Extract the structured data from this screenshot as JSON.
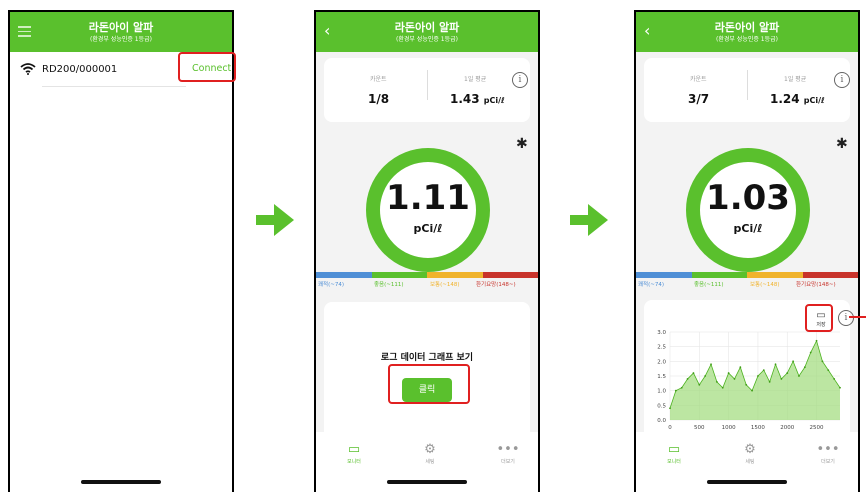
{
  "colors": {
    "brand": "#5ac02d",
    "highlight": "#e02020",
    "scale": [
      "#4f8fd6",
      "#5ac02d",
      "#f0b32c",
      "#c8332b"
    ]
  },
  "app": {
    "title": "라돈아이 알파",
    "subtitle": "(환경부 성능인증 1등급)"
  },
  "screen1": {
    "device_name": "RD200/000001",
    "connect_label": "Connect",
    "icons": {
      "menu": "menu-icon",
      "wifi": "wifi-icon"
    }
  },
  "screen2": {
    "count_label": "카운트",
    "count_value": "1/8",
    "avg_label": "1일 평균",
    "avg_value": "1.43",
    "avg_unit": "pCi/ℓ",
    "reading": "1.11",
    "reading_unit": "pCi/ℓ",
    "scale_labels": [
      "쾌적(~74)",
      "좋음(~111)",
      "보통(~148)",
      "환기요망(148~)"
    ],
    "log_title": "로그 데이터 그래프 보기",
    "click_label": "클릭"
  },
  "screen3": {
    "count_label": "카운트",
    "count_value": "3/7",
    "avg_label": "1일 평균",
    "avg_value": "1.24",
    "avg_unit": "pCi/ℓ",
    "reading": "1.03",
    "reading_unit": "pCi/ℓ",
    "scale_labels": [
      "쾌적(~74)",
      "좋음(~111)",
      "보통(~148)",
      "환기요망(148~)"
    ],
    "save_label": "저장"
  },
  "tabs": [
    {
      "label": "모니터",
      "icon": "monitor-icon"
    },
    {
      "label": "세팅",
      "icon": "gear-icon"
    },
    {
      "label": "더보기",
      "icon": "more-icon"
    }
  ],
  "chart_data": {
    "type": "area",
    "title": "",
    "xlabel": "",
    "ylabel": "",
    "xlim": [
      0,
      2900
    ],
    "ylim": [
      0,
      3.0
    ],
    "x_ticks": [
      "0",
      "500",
      "1000",
      "1500",
      "2000",
      "2500"
    ],
    "y_ticks": [
      "0.0",
      "0.5",
      "1.0",
      "1.5",
      "2.0",
      "2.5",
      "3.0"
    ],
    "grid": true,
    "series": [
      {
        "x": [
          0,
          100,
          200,
          300,
          400,
          500,
          600,
          700,
          800,
          900,
          1000,
          1100,
          1200,
          1300,
          1400,
          1500,
          1600,
          1700,
          1800,
          1900,
          2000,
          2100,
          2200,
          2300,
          2400,
          2500,
          2600,
          2700,
          2800,
          2900
        ],
        "values": [
          0.4,
          1.0,
          1.1,
          1.4,
          1.6,
          1.2,
          1.5,
          1.9,
          1.3,
          1.1,
          1.6,
          1.4,
          1.8,
          1.2,
          1.0,
          1.5,
          1.7,
          1.3,
          1.9,
          1.4,
          1.6,
          2.0,
          1.5,
          1.8,
          2.3,
          2.7,
          2.0,
          1.7,
          1.4,
          1.1
        ]
      }
    ]
  }
}
